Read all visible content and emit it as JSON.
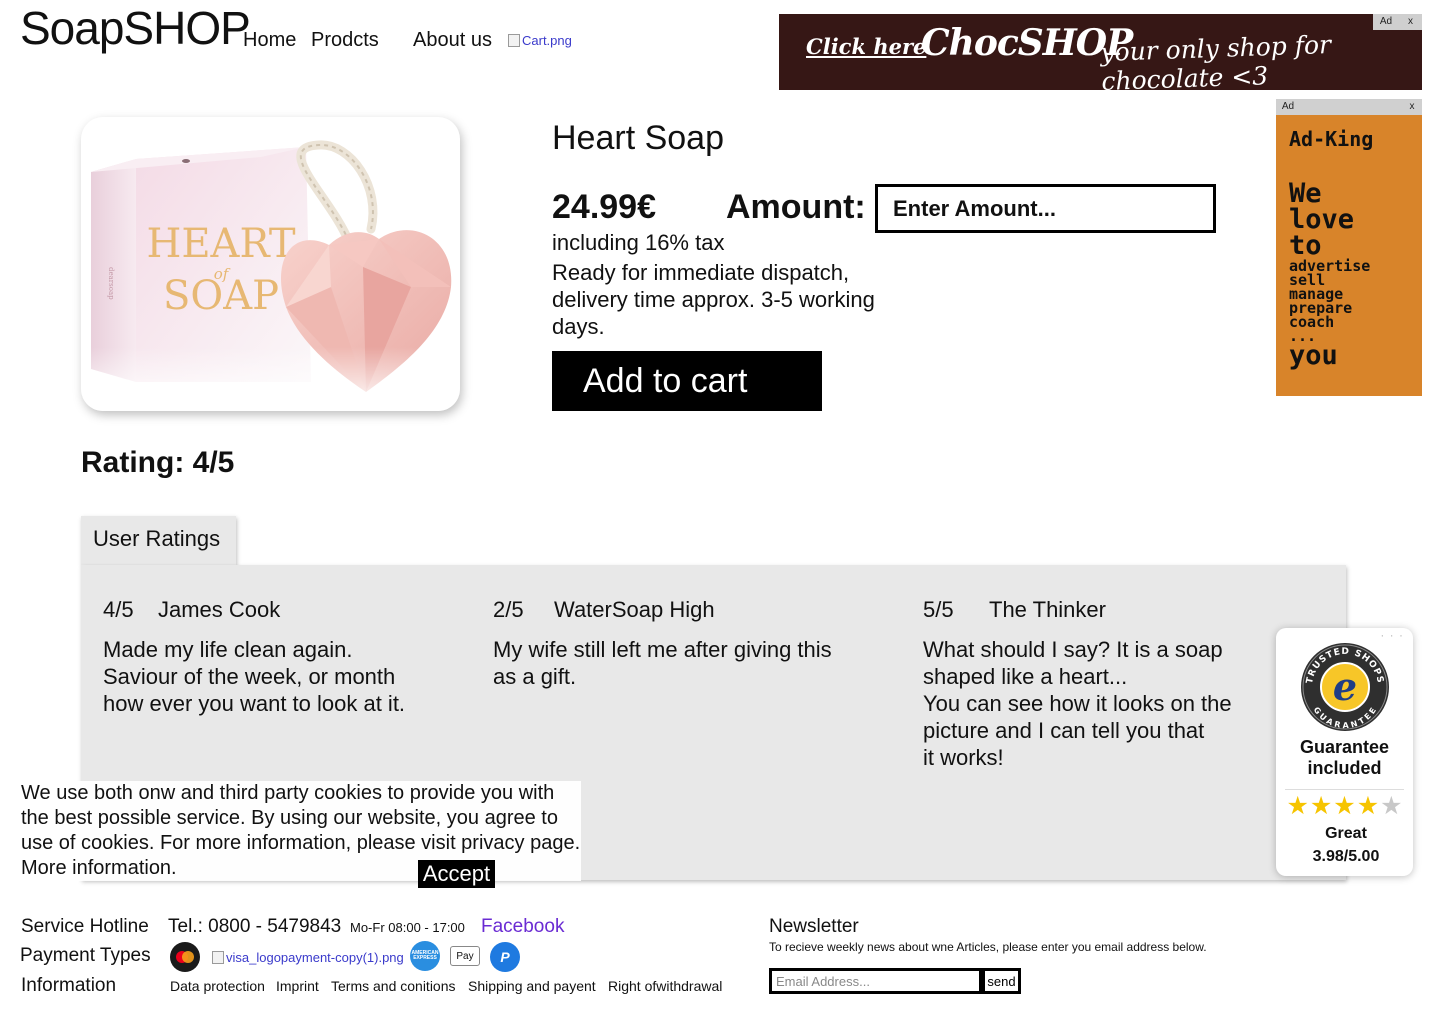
{
  "header": {
    "logo": "SoapSHOP",
    "nav": [
      "Home",
      "Prodcts",
      "About us"
    ],
    "cart_alt": "Cart.png"
  },
  "ad_top": {
    "tag": "Ad",
    "close": "x",
    "click": "Click here",
    "brand": "ChocSHOP",
    "slogan": "your only shop for chocolate <3",
    "background": "#361715"
  },
  "ad_side": {
    "tag": "Ad",
    "close": "x",
    "title": "Ad-King",
    "line_we": "We",
    "line_love": "love",
    "line_to": "to",
    "verbs": [
      "advertise",
      "sell",
      "manage",
      "prepare",
      "coach",
      "..."
    ],
    "line_you": "you",
    "background": "#d8842a"
  },
  "product": {
    "image_box": {
      "brand": "dearsoap",
      "text_1": "HEART",
      "text_2": "of",
      "text_3": "SOAP"
    },
    "title": "Heart Soap",
    "price": "24.99€",
    "amount_label": "Amount:",
    "amount_placeholder": "Enter Amount...",
    "tax": "including 16% tax",
    "dispatch": "Ready for immediate dispatch, delivery time approx. 3-5 working days.",
    "add_to_cart": "Add to cart"
  },
  "rating": "Rating: 4/5",
  "reviews": {
    "tab": "User Ratings",
    "items": [
      {
        "score": "4/5",
        "name": "James Cook",
        "lines": [
          "Made my life clean again.",
          "Saviour of the week, or month",
          "how ever you want to look at it."
        ]
      },
      {
        "score": "2/5",
        "name": "WaterSoap High",
        "lines": [
          "My wife still left me after giving this",
          "as a gift."
        ]
      },
      {
        "score": "5/5",
        "name": "The Thinker",
        "lines": [
          "What should I say? It is a soap",
          "shaped like a heart...",
          "You can see how it looks on the",
          "picture and I can tell you that",
          "it works!"
        ]
      }
    ]
  },
  "cookie": {
    "text": "We use both onw and third party cookies to provide you with the best possible service. By using our website, you agree to use of cookies. For more information, please visit privacy page.  More information.",
    "accept": "Accept"
  },
  "trusted": {
    "badge_top": "TRUSTED SHOPS",
    "badge_bottom": "GUARANTEE",
    "badge_letter": "e",
    "guarantee": "Guarantee included",
    "stars": 4,
    "stars_max": 5,
    "label": "Great",
    "score": "3.98/5.00"
  },
  "footer": {
    "hotline_label": "Service Hotline",
    "tel": "Tel.: 0800 - 5479843",
    "hours": "Mo-Fr 08:00 - 17:00",
    "facebook": "Facebook",
    "payment_label": "Payment Types",
    "visa_alt": "visa_logopayment-copy(1).png",
    "amex": "AMERICAN EXPRESS",
    "applepay": "Pay",
    "info_label": "Information",
    "links": [
      "Data protection",
      "Imprint",
      "Terms and conitions",
      "Shipping and payent",
      "Right ofwithdrawal"
    ]
  },
  "newsletter": {
    "title": "Newsletter",
    "text": "To recieve weekly news about wne Articles, please enter you email address below.",
    "placeholder": "Email Address...",
    "send": "send"
  }
}
